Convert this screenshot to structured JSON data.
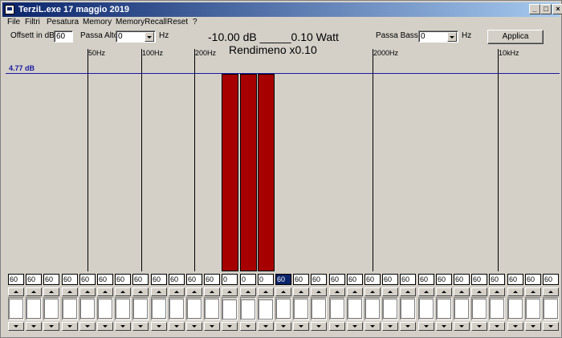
{
  "window": {
    "title": "TerziL.exe 17 maggio 2019"
  },
  "menu": [
    "File",
    "Filtri",
    "Pesatura",
    "Memory",
    "MemoryRecall",
    "Reset",
    "?"
  ],
  "controls": {
    "offset_label": "Offsett  in dB",
    "offset_value": "60",
    "passa_alto_label": "Passa Alto",
    "passa_alto_value": "0",
    "passa_alto_unit": "Hz",
    "passa_basso_label": "Passa Basso",
    "passa_basso_value": "0",
    "passa_basso_unit": "Hz",
    "applica_label": "Applica"
  },
  "readout": {
    "line1": "-10.00 dB _____0.10 Watt",
    "line2": "Rendimeno x0.10"
  },
  "plot": {
    "reference_label": "4.77 dB",
    "freq_labels": [
      "50Hz",
      "100Hz",
      "200Hz",
      "2000Hz",
      "10kHz"
    ]
  },
  "bands": {
    "values": [
      "60",
      "60",
      "60",
      "60",
      "60",
      "60",
      "60",
      "60",
      "60",
      "60",
      "60",
      "60",
      "0",
      "0",
      "0",
      "60",
      "60",
      "60",
      "60",
      "60",
      "60",
      "60",
      "60",
      "60",
      "60",
      "60",
      "60",
      "60",
      "60",
      "60",
      "60"
    ],
    "selected_index": 15,
    "bar_indices": [
      12,
      13,
      14
    ]
  },
  "colors": {
    "bar": "#a60000",
    "reference_line": "#1a1aa0",
    "titlebar": "#0a246a"
  }
}
